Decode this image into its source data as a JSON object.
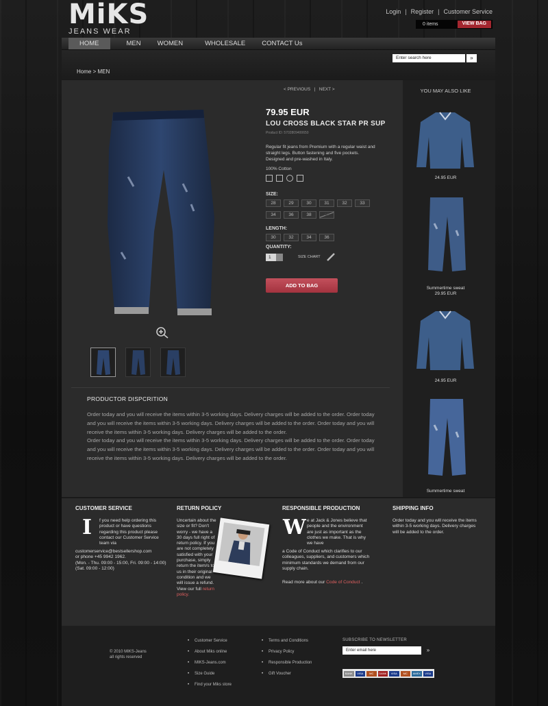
{
  "header": {
    "brand": "MiKS",
    "brand_sub": "JEANS WEAR",
    "links": [
      "Login",
      "Register",
      "Customer Service"
    ],
    "cart_items": "0 items",
    "view_bag": "VIEW BAG"
  },
  "nav": {
    "items": [
      "HOME",
      "MEN",
      "WOMEN",
      "WHOLESALE",
      "CONTACT Us"
    ]
  },
  "search": {
    "placeholder": "Enter search here",
    "button": "»"
  },
  "breadcrumb": "Home >  MEN",
  "product": {
    "prev": "< PREVIOUS",
    "next": "NEXT >",
    "price": "79.95 EUR",
    "name": "LOU CROSS BLACK STAR PR SUP",
    "id": "Product ID: 5702809400650",
    "desc": "Regular fit jeans from Premium with a regular waist and straight legs. Button fastening and five pockets. Designed and pre-washed in Italy.",
    "material": "100% Cotton",
    "care_icons": [
      "wash-icon",
      "iron-icon",
      "dryclean-icon",
      "no-tumble-icon"
    ],
    "size_label": "SIZE:",
    "sizes": [
      "28",
      "29",
      "30",
      "31",
      "32",
      "33",
      "34",
      "36",
      "38",
      "40"
    ],
    "length_label": "LENGTH:",
    "lengths": [
      "30",
      "32",
      "34",
      "36"
    ],
    "quantity_label": "QUANTITY:",
    "quantity": "1",
    "size_chart": "SIZE CHART",
    "add_to_bag": "ADD TO BAG"
  },
  "description": {
    "title": "PRODUCTOR  DISPCRITION",
    "body": "Order today and you will receive the items within 3-5 working days. Delivery charges will be added to the order. Order today and you will receive the items within 3-5 working days. Delivery charges will be added to the order.  Order today and you will receive the items within 3-5 working days. Delivery charges will be added to the order.",
    "body2": "Order today and you will receive the items within 3-5 working days. Delivery charges will be added to the order. Order today and you will receive the items within 3-5 working days. Delivery charges will be added to the order.  Order today and you will receive the items within 3-5 working days. Delivery charges will be added to the order."
  },
  "related": {
    "title": "YOU MAY ALSO LIKE",
    "items": [
      {
        "name": "",
        "price": "24.95 EUR"
      },
      {
        "name": "Summertime sweat",
        "price": "29.95 EUR"
      },
      {
        "name": "",
        "price": "24.95 EUR"
      },
      {
        "name": "Summertime sweat",
        "price": ""
      }
    ]
  },
  "info": {
    "cs_title": "CUSTOMER SERVICE",
    "cs_initial": "I",
    "cs_text1": "f you need help ordering this product or have questions regarding this product please contact our Customer Service team via",
    "cs_email": "customerservice@bestsellershop.com",
    "cs_phone": "or phone +45 9942 1962.",
    "cs_hours1": "(Mon. - Thu. 09:00 - 15:00, Fri. 09:00 - 14:00)",
    "cs_hours2": "(Sat.    09:00 - 12:00)",
    "rp_title": "RETURN POLICY",
    "rp_text": "Uncertain about the size or fit? Don't worry - we have a 30 days full right of return policy. If you are not completely satisfied with your purchase, simply return the item/s to us in their original condition and we will issue a refund. View our full",
    "rp_link": "return policy.",
    "resp_title": "RESPONSIBLE PRODUCTION",
    "resp_initial": "W",
    "resp_text1": "e at Jack & Jones believe that people and the environment are just as important as the clothes we make. That is why we have",
    "resp_text2": "a Code of Conduct which clarifies to our colleagues, suppliers, and customers which minimum standards we demand from our supply chain.",
    "resp_read": "Read more about our",
    "resp_link": "Code of Conduct",
    "resp_end": ".",
    "ship_title": "SHIPPING INFO",
    "ship_text": "Order today and you will receive the items within 3-5 working days. Delivery charges will be added to the order."
  },
  "footer": {
    "copy1": "© 2010   MIKS-Jeans",
    "copy2": "all rights reserved",
    "col1": [
      "Customer Service",
      "About  Miks online",
      "MIKS-Jeans.com",
      "Size Guide",
      "Find your Miks store"
    ],
    "col2": [
      "Terms and Conditions",
      "Privacy Policy",
      "Responsible Production",
      "Gift Voucher"
    ],
    "newsletter_title": "SUBSCRIBE TO NEWSLETTER",
    "newsletter_placeholder": "Enter email here",
    "newsletter_button": "»",
    "payment_cards": [
      "BANK",
      "VISA",
      "MC",
      "DANK",
      "VISA",
      "MC",
      "AMEX",
      "VISA"
    ]
  }
}
